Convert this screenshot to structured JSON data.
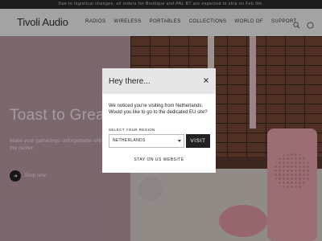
{
  "announcement": "Due to logistical changes, all orders for Boutique and PAL BT are expected to ship on Feb 9th.",
  "header": {
    "logo": "Tivoli Audio",
    "nav": [
      "RADIOS",
      "WIRELESS",
      "PORTABLES",
      "COLLECTIONS",
      "WORLD OF",
      "SUPPORT"
    ],
    "icons": [
      "search-icon",
      "account-icon"
    ]
  },
  "hero": {
    "title": "Toast to Great",
    "text": "Make your gatherings unforgettable with the center.",
    "cta": "Shop now"
  },
  "modal": {
    "title": "Hey there...",
    "close": "×",
    "message": "We noticed you're visiting from Netherlands. Would you like to go to the dedicated EU site?",
    "region_label": "SELECT YOUR REGION",
    "region_value": "NETHERLANDS",
    "visit_label": "VISIT",
    "stay_label": "STAY ON US WEBSITE"
  },
  "colors": {
    "announce_bg": "#2a2a2a",
    "header_bg": "#f4f4f4",
    "hero_pink": "#b89aa2",
    "button_dark": "#222222"
  }
}
